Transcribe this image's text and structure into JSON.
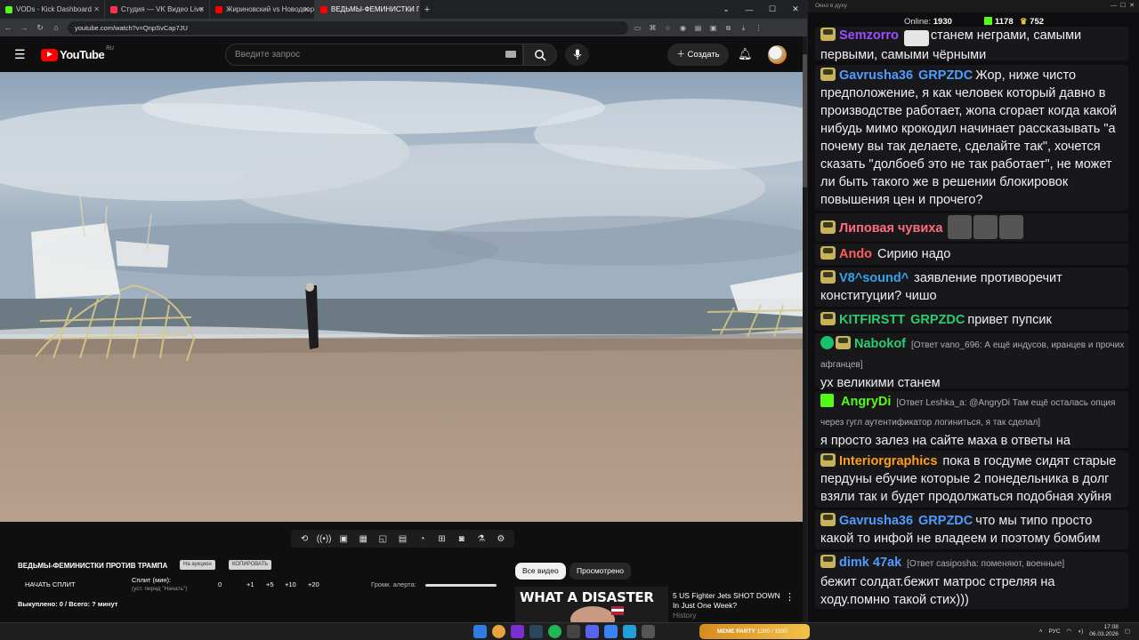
{
  "tabs": [
    {
      "title": "VODs - Kick Dashboard",
      "color": "#53fc18"
    },
    {
      "title": "Студия — VK Видео Live",
      "color": "#ff3347"
    },
    {
      "title": "Жириновский vs Новодворская",
      "color": "#ff0000"
    },
    {
      "title": "ВЕДЬМЫ-ФЕМИНИСТКИ ПРОТ",
      "color": "#ff0000"
    }
  ],
  "url": "youtube.com/watch?v=QnpSvCap7JU",
  "yt": {
    "logo": "YouTube",
    "region": "RU",
    "search_placeholder": "Введите запрос",
    "create_label": "Создать"
  },
  "extension": {
    "video_title": "ВЕДЬМЫ-ФЕМИНИСТКИ ПРОТИВ ТРАМПА",
    "chip_on_auction": "На аукцион",
    "chip_copy": "КОПИРОВАТЬ",
    "start_split": "НАЧАТЬ СПЛИТ",
    "split_label": "Сплит (мин):",
    "split_hint": "(уст. перед \"Начать\")",
    "split_value": "0",
    "add_buttons": [
      "+1",
      "+5",
      "+10",
      "+20"
    ],
    "alert_volume": "Громк. алерта:",
    "bought": "Выкуплено: 0 / Всего: ? минут"
  },
  "filters": {
    "all": "Все видео",
    "watched": "Просмотрено"
  },
  "recommended": {
    "thumb_text": "WHAT A DISASTER",
    "title_line1": "5 US Fighter Jets SHOT DOWN",
    "title_line2": "In Just One Week?",
    "channel": "History"
  },
  "chat": {
    "window_title": "Окно в духу",
    "online_label": "Online:",
    "online_count": "1930",
    "kick_count": "1178",
    "other_count": "752",
    "messages": [
      {
        "nick": "Semzorro",
        "color": "#9b4dff",
        "text": "станем неграми, самыми первыми, самыми чёрными"
      },
      {
        "nick": "Gavrusha36",
        "color": "#4f9cff",
        "mention": "GRPZDC",
        "text": "Жор, ниже чисто предположение, я как человек который давно в производстве работает, жопа сгорает когда какой нибудь мимо крокодил начинает рассказывать \"а почему вы так делаете, сделайте так\", хочется сказать \"долбоеб это не так работает\", не может ли быть такого же в решении блокировок повышения цен и прочего?"
      },
      {
        "nick": "Липовая чувиха",
        "color": "#ff6b81",
        "text": ""
      },
      {
        "nick": "Ando",
        "color": "#ff5e5e",
        "text": "Сирию надо"
      },
      {
        "nick": "V8^sound^",
        "color": "#36a2eb",
        "text": "заявление противоречит конституции? чишо"
      },
      {
        "nick": "KITFIRSTT",
        "color": "#2ecc71",
        "mention": "GRPZDC",
        "text": "привет пупсик"
      },
      {
        "nick": "Nabokof",
        "color": "#2ecc71",
        "reply": "[Ответ vano_696: А ещё индусов, иранцев и прочих афганцев]",
        "text": "ух великими станем"
      },
      {
        "nick": "AngryDi",
        "color": "#53fc18",
        "reply": "[Ответ Leshka_a: @AngryDi Там ещё осталась опция через гугл аутентификатор логиниться, я так сделал]",
        "text": "я просто залез на сайте маха в ответы на вопросы."
      },
      {
        "nick": "Interiorgraphics",
        "color": "#ff9f1c",
        "text": "пока в госдуме сидят старые пердуны ебучие которые 2 понедельника в долг взяли так и будет продолжаться подобная хуйня"
      },
      {
        "nick": "Gavrusha36",
        "color": "#4f9cff",
        "mention": "GRPZDC",
        "text": "что мы типо просто какой то инфой не владеем и поэтому бомбим"
      },
      {
        "nick": "dimk 47ak",
        "color": "#4f9cff",
        "reply": "[Ответ casiposha: поменяют, военные]",
        "text": "бежит солдат.бежит матрос стреляя на ходу.помню такой стих)))"
      }
    ]
  },
  "taskbar": {
    "pill_text": "MEME PARTY",
    "pill_sub": "1200 / 1500",
    "lang": "РУС",
    "time": "17:08",
    "date": "06.03.2026"
  }
}
